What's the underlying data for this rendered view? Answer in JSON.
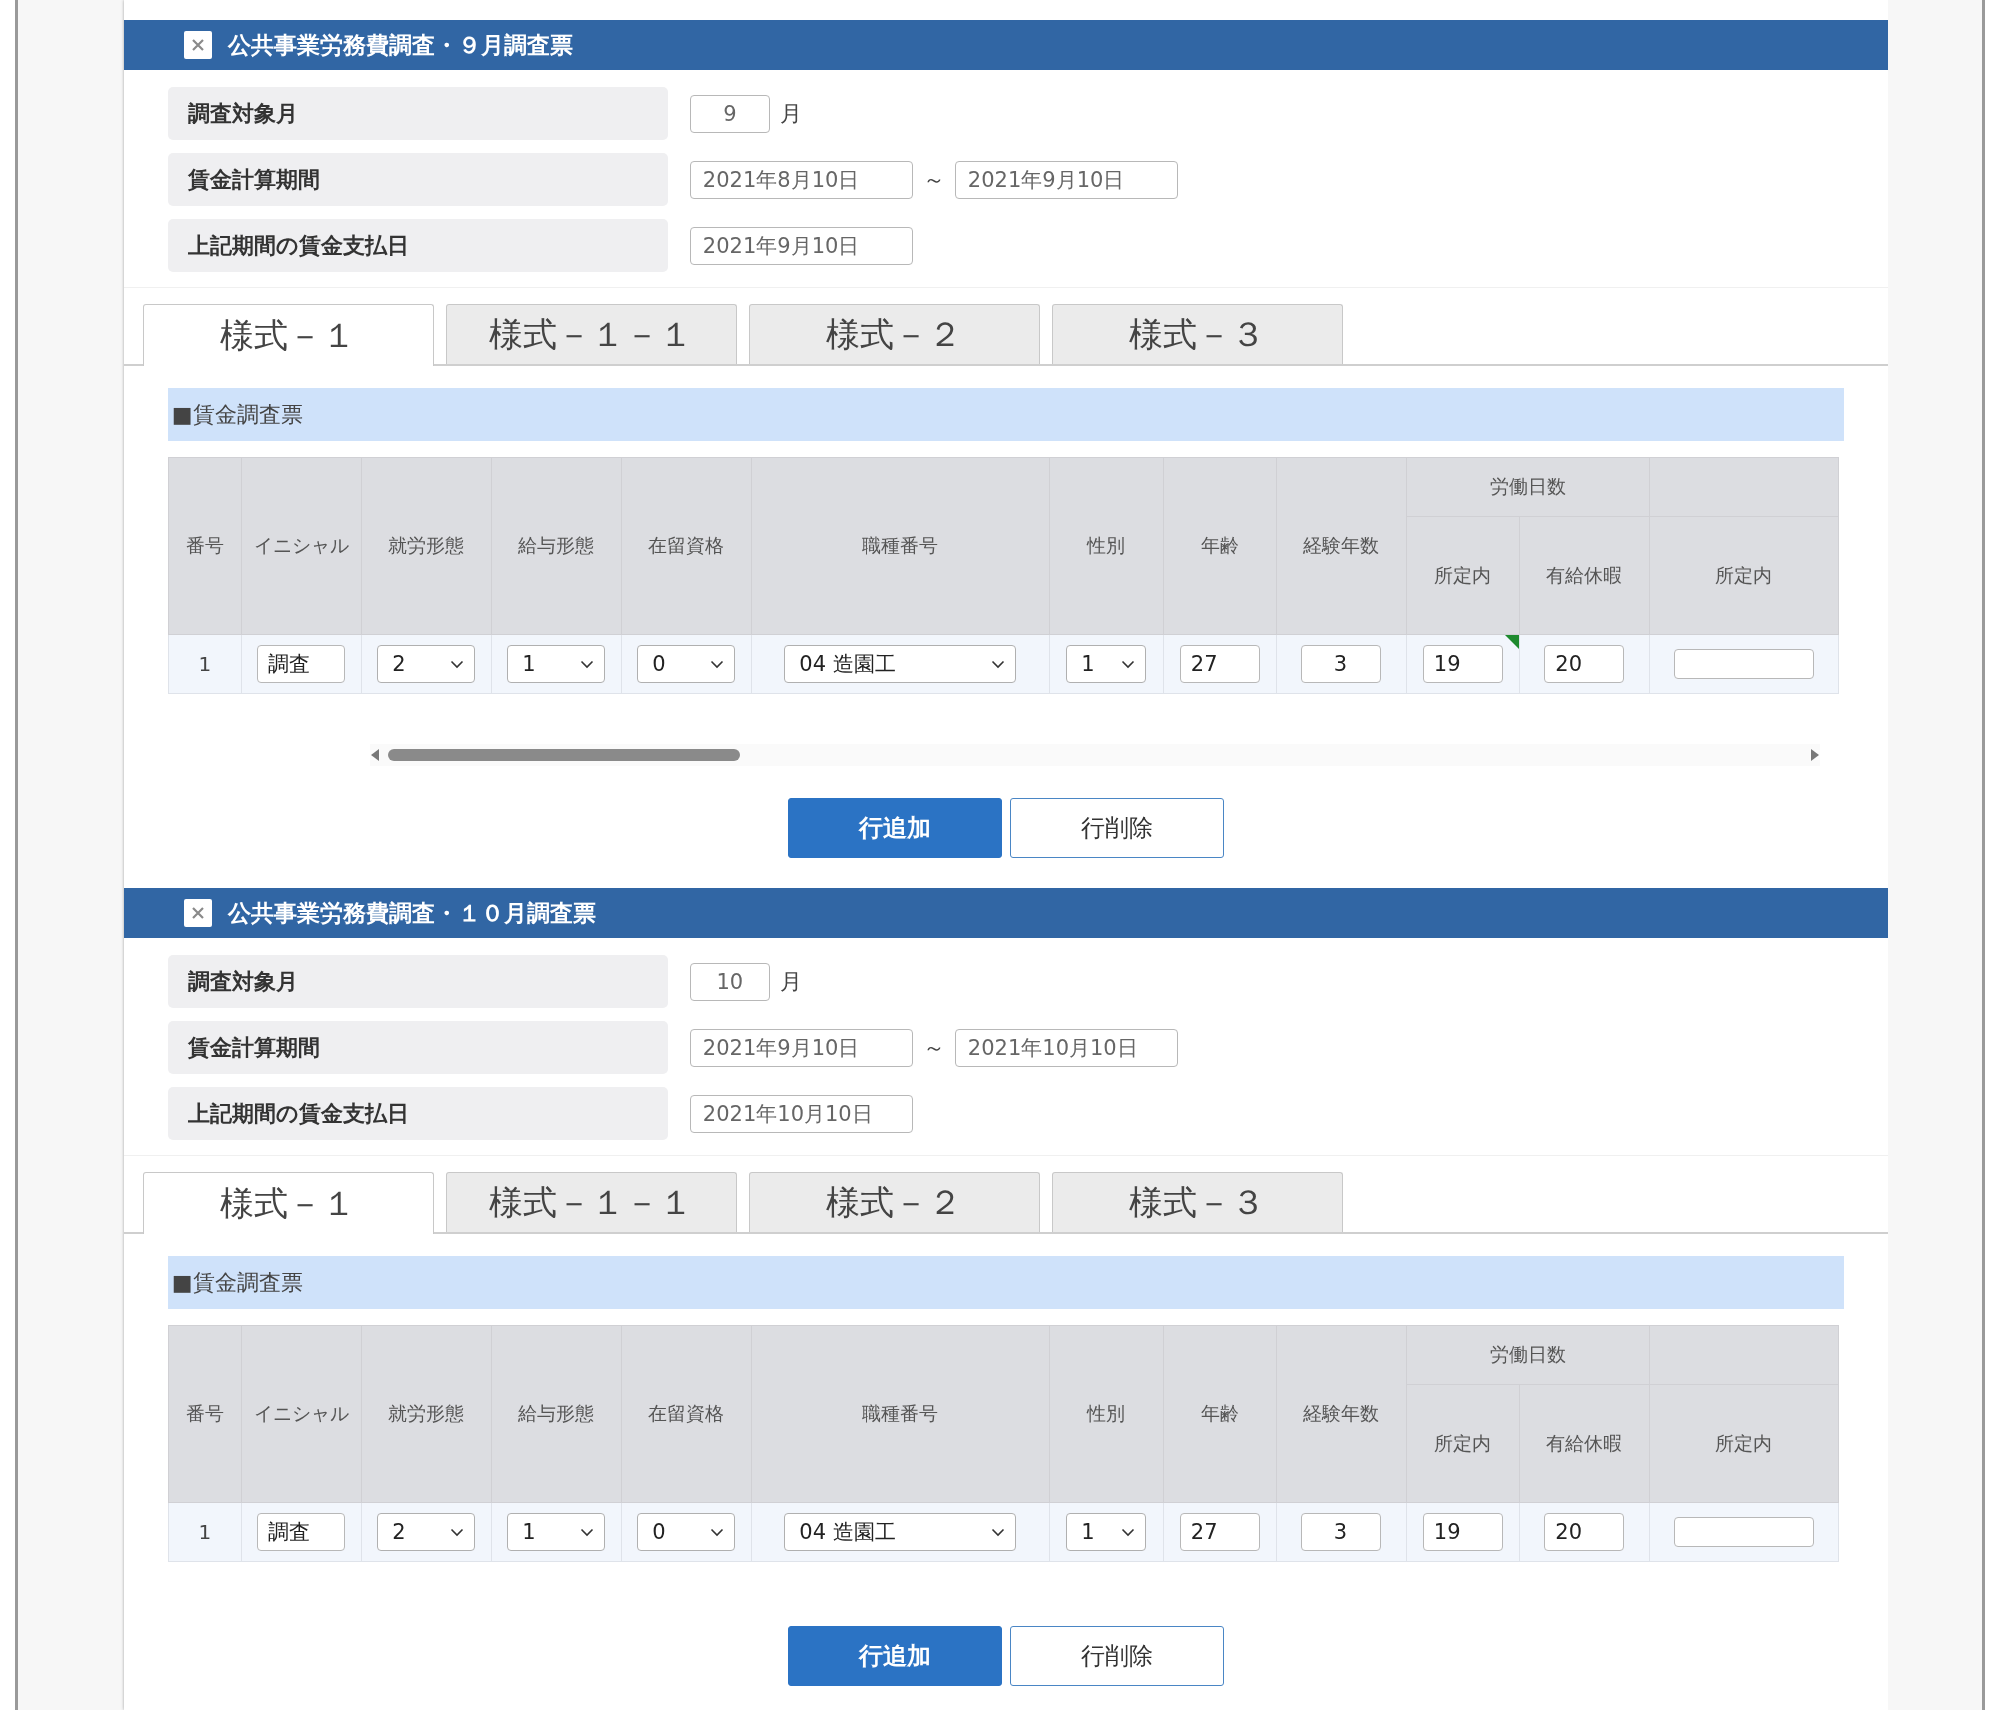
{
  "sections": [
    {
      "title": "公共事業労務費調査・９月調査票",
      "fields": [
        {
          "label": "調査対象月",
          "kind": "month",
          "value": "9",
          "unit": "月"
        },
        {
          "label": "賃金計算期間",
          "kind": "range",
          "from": "2021年8月10日",
          "separator": "～",
          "to": "2021年9月10日"
        },
        {
          "label": "上記期間の賃金支払日",
          "kind": "date",
          "value": "2021年9月10日"
        }
      ],
      "tabs": [
        {
          "label": "様式－１",
          "selected": true
        },
        {
          "label": "様式－１－１",
          "selected": false
        },
        {
          "label": "様式－２",
          "selected": false
        },
        {
          "label": "様式－３",
          "selected": false
        }
      ],
      "panel_title": "■賃金調査票",
      "header_rows": [
        [
          {
            "label": "番号",
            "rowspan": 2
          },
          {
            "label": "イニシャル",
            "rowspan": 2
          },
          {
            "label": "就労形態",
            "rowspan": 2
          },
          {
            "label": "給与形態",
            "rowspan": 2
          },
          {
            "label": "在留資格",
            "rowspan": 2
          },
          {
            "label": "職種番号",
            "rowspan": 2
          },
          {
            "label": "性別",
            "rowspan": 2
          },
          {
            "label": "年齢",
            "rowspan": 2
          },
          {
            "label": "経験年数",
            "rowspan": 2
          },
          {
            "label": "労働日数",
            "colspan": 2
          }
        ],
        [
          {
            "label": "所定内"
          },
          {
            "label": "有給休暇"
          },
          {
            "label": "所定内"
          }
        ]
      ],
      "rows": [
        {
          "cells": [
            {
              "kind": "text",
              "value": "1"
            },
            {
              "kind": "input",
              "value": "調査"
            },
            {
              "kind": "select",
              "value": "2"
            },
            {
              "kind": "select",
              "value": "1"
            },
            {
              "kind": "select",
              "value": "0"
            },
            {
              "kind": "select",
              "value": "04 造園工"
            },
            {
              "kind": "select",
              "value": "1"
            },
            {
              "kind": "input",
              "value": "27"
            },
            {
              "kind": "input",
              "value": "3"
            },
            {
              "kind": "input",
              "value": "19",
              "flagged": true
            },
            {
              "kind": "input",
              "value": "20"
            },
            {
              "kind": "input"
            }
          ]
        }
      ],
      "scrollbar": true,
      "buttons": [
        {
          "label": "行追加",
          "kind": "primary"
        },
        {
          "label": "行削除",
          "kind": "secondary"
        }
      ]
    },
    {
      "title": "公共事業労務費調査・１０月調査票",
      "fields": [
        {
          "label": "調査対象月",
          "kind": "month",
          "value": "10",
          "unit": "月"
        },
        {
          "label": "賃金計算期間",
          "kind": "range",
          "from": "2021年9月10日",
          "separator": "～",
          "to": "2021年10月10日"
        },
        {
          "label": "上記期間の賃金支払日",
          "kind": "date",
          "value": "2021年10月10日"
        }
      ],
      "tabs": [
        {
          "label": "様式－１",
          "selected": true
        },
        {
          "label": "様式－１－１",
          "selected": false
        },
        {
          "label": "様式－２",
          "selected": false
        },
        {
          "label": "様式－３",
          "selected": false
        }
      ],
      "panel_title": "■賃金調査票",
      "header_rows": [
        [
          {
            "label": "番号",
            "rowspan": 2
          },
          {
            "label": "イニシャル",
            "rowspan": 2
          },
          {
            "label": "就労形態",
            "rowspan": 2
          },
          {
            "label": "給与形態",
            "rowspan": 2
          },
          {
            "label": "在留資格",
            "rowspan": 2
          },
          {
            "label": "職種番号",
            "rowspan": 2
          },
          {
            "label": "性別",
            "rowspan": 2
          },
          {
            "label": "年齢",
            "rowspan": 2
          },
          {
            "label": "経験年数",
            "rowspan": 2
          },
          {
            "label": "労働日数",
            "colspan": 2
          }
        ],
        [
          {
            "label": "所定内"
          },
          {
            "label": "有給休暇"
          },
          {
            "label": "所定内"
          }
        ]
      ],
      "rows": [
        {
          "cells": [
            {
              "kind": "text",
              "value": "1"
            },
            {
              "kind": "input",
              "value": "調査"
            },
            {
              "kind": "select",
              "value": "2"
            },
            {
              "kind": "select",
              "value": "1"
            },
            {
              "kind": "select",
              "value": "0"
            },
            {
              "kind": "select",
              "value": "04 造園工"
            },
            {
              "kind": "select",
              "value": "1"
            },
            {
              "kind": "input",
              "value": "27"
            },
            {
              "kind": "input",
              "value": "3"
            },
            {
              "kind": "input",
              "value": "19"
            },
            {
              "kind": "input",
              "value": "20"
            },
            {
              "kind": "input"
            }
          ]
        }
      ],
      "scrollbar": false,
      "buttons": [
        {
          "label": "行追加",
          "kind": "primary"
        },
        {
          "label": "行削除",
          "kind": "secondary"
        }
      ]
    }
  ]
}
